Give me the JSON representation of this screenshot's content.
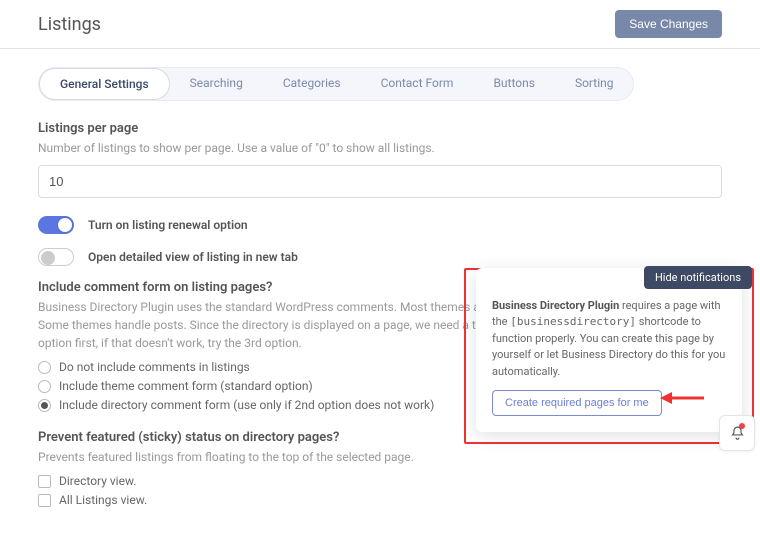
{
  "page_title": "Listings",
  "save_button": "Save Changes",
  "tabs": [
    {
      "label": "General Settings",
      "active": true
    },
    {
      "label": "Searching",
      "active": false
    },
    {
      "label": "Categories",
      "active": false
    },
    {
      "label": "Contact Form",
      "active": false
    },
    {
      "label": "Buttons",
      "active": false
    },
    {
      "label": "Sorting",
      "active": false
    }
  ],
  "listings_per_page": {
    "title": "Listings per page",
    "desc": "Number of listings to show per page. Use a value of \"0\" to show all listings.",
    "value": "10"
  },
  "toggle_renewal": {
    "label": "Turn on listing renewal option",
    "on": true
  },
  "toggle_newtab": {
    "label": "Open detailed view of listing in new tab",
    "on": false
  },
  "comment_form": {
    "title": "Include comment form on listing pages?",
    "desc": "Business Directory Plugin uses the standard WordPress comments. Most themes allow for comments on posts, not pages. Some themes handle posts. Since the directory is displayed on a page, we need a theme that can handle both. Use the 2nd option first, if that doesn't work, try the 3rd option.",
    "options": [
      {
        "label": "Do not include comments in listings",
        "checked": false
      },
      {
        "label": "Include theme comment form (standard option)",
        "checked": false
      },
      {
        "label": "Include directory comment form (use only if 2nd option does not work)",
        "checked": true
      }
    ]
  },
  "sticky": {
    "title": "Prevent featured (sticky) status on directory pages?",
    "desc": "Prevents featured listings from floating to the top of the selected page.",
    "options": [
      {
        "label": "Directory view.",
        "checked": false
      },
      {
        "label": "All Listings view.",
        "checked": false
      }
    ]
  },
  "notification": {
    "hide_label": "Hide notifications",
    "text_bold": "Business Directory Plugin",
    "text_1": " requires a page with the ",
    "shortcode": "[businessdirectory]",
    "text_2": " shortcode to function properly. You can create this page by yourself or let Business Directory do this for you automatically.",
    "button": "Create required pages for me"
  }
}
